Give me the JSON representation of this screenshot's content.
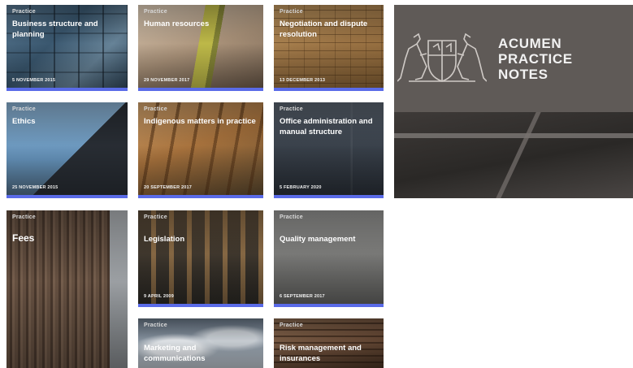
{
  "cards": [
    {
      "category": "Practice",
      "title": "Business structure and planning",
      "date": "5 NOVEMBER 2015"
    },
    {
      "category": "Practice",
      "title": "Human resources",
      "date": "29 NOVEMBER 2017"
    },
    {
      "category": "Practice",
      "title": "Negotiation and dispute resolution",
      "date": "13 DECEMBER 2013"
    },
    {
      "category": "Practice",
      "title": "Ethics",
      "date": "25 NOVEMBER 2015"
    },
    {
      "category": "Practice",
      "title": "Indigenous matters in practice",
      "date": "20 SEPTEMBER 2017"
    },
    {
      "category": "Practice",
      "title": "Office administration and manual structure",
      "date": "5 FEBRUARY 2020"
    },
    {
      "category": "Practice",
      "title": "Fees",
      "date": ""
    },
    {
      "category": "Practice",
      "title": "Legislation",
      "date": "9 APRIL 2009"
    },
    {
      "category": "Practice",
      "title": "Quality management",
      "date": "6 SEPTEMBER 2017"
    },
    {
      "category": "Practice",
      "title": "Marketing and communications",
      "date": ""
    },
    {
      "category": "Practice",
      "title": "Risk management and insurances",
      "date": ""
    }
  ],
  "brand": {
    "line1": "ACUMEN",
    "line2": "PRACTICE",
    "line3": "NOTES",
    "logo_icon": "kangaroo-crest-icon"
  },
  "colors": {
    "accent_bar": "#5a6be8",
    "panel": "#5f5a57"
  }
}
